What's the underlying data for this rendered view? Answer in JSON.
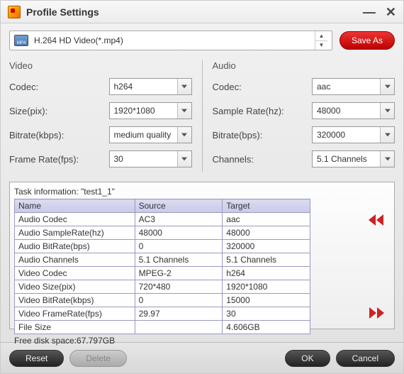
{
  "window": {
    "title": "Profile Settings"
  },
  "format": {
    "label": "H.264 HD Video(*.mp4)",
    "icon_text": "MP4"
  },
  "saveas_label": "Save As",
  "video": {
    "heading": "Video",
    "codec_label": "Codec:",
    "codec_value": "h264",
    "size_label": "Size(pix):",
    "size_value": "1920*1080",
    "bitrate_label": "Bitrate(kbps):",
    "bitrate_value": "medium quality",
    "framerate_label": "Frame Rate(fps):",
    "framerate_value": "30"
  },
  "audio": {
    "heading": "Audio",
    "codec_label": "Codec:",
    "codec_value": "aac",
    "samplerate_label": "Sample Rate(hz):",
    "samplerate_value": "48000",
    "bitrate_label": "Bitrate(bps):",
    "bitrate_value": "320000",
    "channels_label": "Channels:",
    "channels_value": "5.1 Channels"
  },
  "task": {
    "title": "Task information: \"test1_1\"",
    "columns": {
      "name": "Name",
      "source": "Source",
      "target": "Target"
    },
    "rows": [
      {
        "name": "Audio Codec",
        "source": "AC3",
        "target": "aac"
      },
      {
        "name": "Audio SampleRate(hz)",
        "source": "48000",
        "target": "48000"
      },
      {
        "name": "Audio BitRate(bps)",
        "source": "0",
        "target": "320000"
      },
      {
        "name": "Audio Channels",
        "source": "5.1 Channels",
        "target": "5.1 Channels"
      },
      {
        "name": "Video Codec",
        "source": "MPEG-2",
        "target": "h264"
      },
      {
        "name": "Video Size(pix)",
        "source": "720*480",
        "target": "1920*1080"
      },
      {
        "name": "Video BitRate(kbps)",
        "source": "0",
        "target": "15000"
      },
      {
        "name": "Video FrameRate(fps)",
        "source": "29.97",
        "target": "30"
      },
      {
        "name": "File Size",
        "source": "",
        "target": "4.606GB"
      }
    ],
    "free_space": "Free disk space:67.797GB"
  },
  "footer": {
    "reset": "Reset",
    "delete": "Delete",
    "ok": "OK",
    "cancel": "Cancel"
  }
}
